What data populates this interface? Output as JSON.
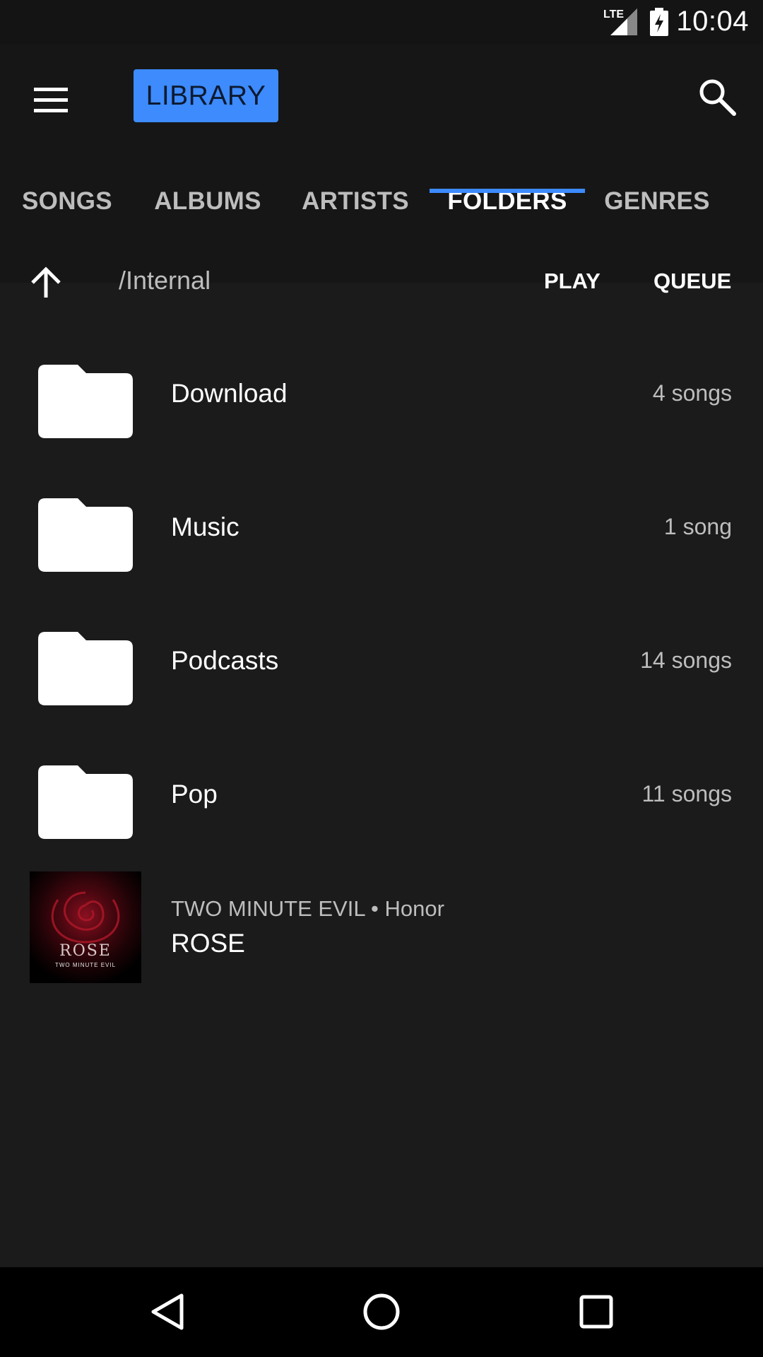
{
  "status_bar": {
    "network": "LTE",
    "time": "10:04"
  },
  "app_bar": {
    "title": "LIBRARY"
  },
  "tabs": [
    {
      "label": "SONGS",
      "active": false
    },
    {
      "label": "ALBUMS",
      "active": false
    },
    {
      "label": "ARTISTS",
      "active": false
    },
    {
      "label": "FOLDERS",
      "active": true
    },
    {
      "label": "GENRES",
      "active": false
    }
  ],
  "path_bar": {
    "path": "/Internal",
    "play_label": "PLAY",
    "queue_label": "QUEUE"
  },
  "folders": [
    {
      "name": "Download",
      "count": "4 songs",
      "icon": "folder-icon"
    },
    {
      "name": "Music",
      "count": "1 song",
      "icon": "folder-icon"
    },
    {
      "name": "Podcasts",
      "count": "14 songs",
      "icon": "folder-icon"
    },
    {
      "name": "Pop",
      "count": "11 songs",
      "icon": "folder-icon"
    }
  ],
  "song": {
    "meta": "TWO MINUTE EVIL • Honor",
    "title": "ROSE",
    "art_title": "ROSE",
    "art_subtitle": "TWO MINUTE EVIL"
  },
  "colors": {
    "accent": "#3d8bfd",
    "background": "#1b1b1c",
    "app_bar": "#161617"
  }
}
